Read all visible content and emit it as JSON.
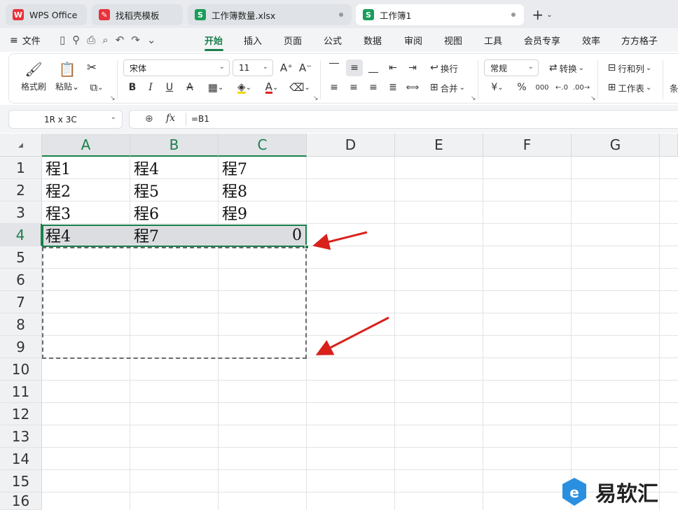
{
  "tabs": [
    {
      "label": "WPS Office",
      "icon": "wps-logo-icon"
    },
    {
      "label": "找稻壳模板",
      "icon": "docer-icon"
    },
    {
      "label": "工作簿数量.xlsx",
      "icon": "sheet-s-icon"
    },
    {
      "label": "工作簿1",
      "icon": "sheet-s-icon"
    }
  ],
  "new_tab": "+",
  "menu": {
    "file": "文件",
    "tabs": [
      "开始",
      "插入",
      "页面",
      "公式",
      "数据",
      "审阅",
      "视图",
      "工具",
      "会员专享",
      "效率",
      "方方格子"
    ],
    "active": "开始"
  },
  "ribbon": {
    "format_painter": "格式刷",
    "paste": "粘贴",
    "font_name": "宋体",
    "font_size": "11",
    "bold": "B",
    "italic": "I",
    "underline": "U",
    "strike": "A",
    "wrap": "换行",
    "merge": "合并",
    "number_format": "常规",
    "convert": "转换",
    "rows_cols": "行和列",
    "worksheet": "工作表",
    "percent": "%",
    "thousands": "000",
    "currency": "¥"
  },
  "formula_bar": {
    "name_box": "1R x 3C",
    "fx": "fx",
    "formula": "=B1"
  },
  "sheet": {
    "columns": [
      "A",
      "B",
      "C",
      "D",
      "E",
      "F",
      "G"
    ],
    "rows": [
      "1",
      "2",
      "3",
      "4",
      "5",
      "6",
      "7",
      "8",
      "9",
      "10",
      "11",
      "12",
      "13",
      "14",
      "15",
      "16"
    ],
    "cells": {
      "A1": "程1",
      "B1": "程4",
      "C1": "程7",
      "A2": "程2",
      "B2": "程5",
      "C2": "程8",
      "A3": "程3",
      "B3": "程6",
      "C3": "程9",
      "A4": "程4",
      "B4": "程7",
      "C4": "0"
    }
  },
  "watermark": "易软汇",
  "colors": {
    "accent": "#1a7f4c",
    "arrow": "#d9211c"
  }
}
